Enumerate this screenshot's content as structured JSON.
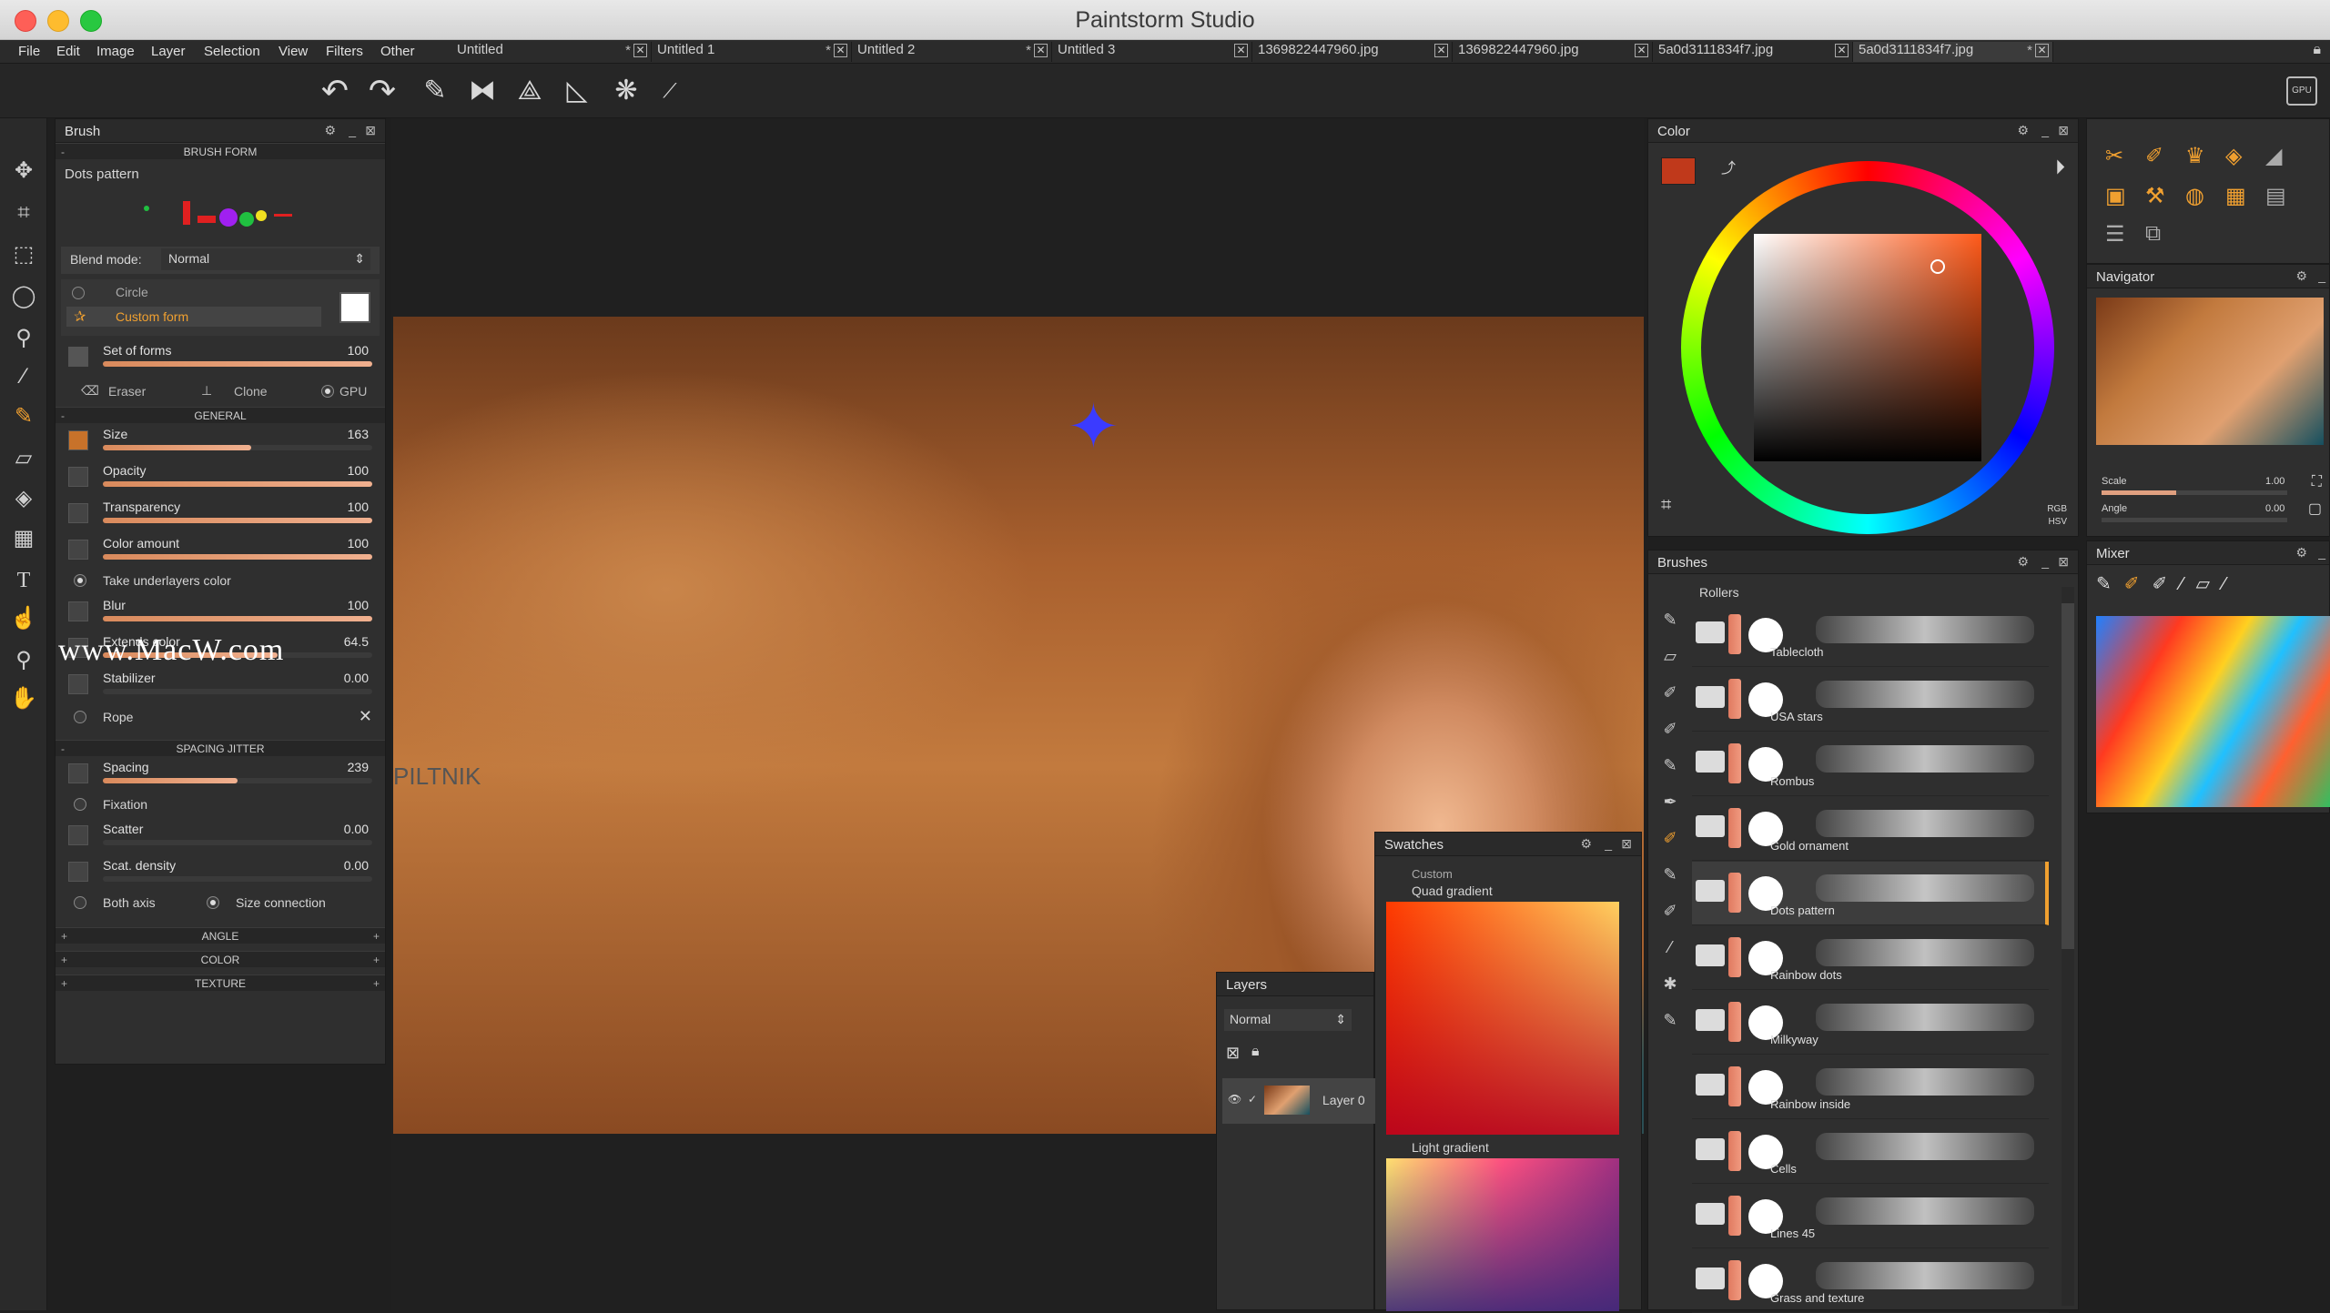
{
  "window": {
    "title": "Paintstorm Studio"
  },
  "menu": [
    "File",
    "Edit",
    "Image",
    "Layer",
    "Selection",
    "View",
    "Filters",
    "Other"
  ],
  "tabs": [
    {
      "label": "Untitled",
      "modified": "*",
      "active": false
    },
    {
      "label": "Untitled 1",
      "modified": "*",
      "active": false
    },
    {
      "label": "Untitled 2",
      "modified": "*",
      "active": false
    },
    {
      "label": "Untitled 3",
      "modified": "",
      "active": false
    },
    {
      "label": "1369822447960.jpg",
      "modified": "",
      "active": false
    },
    {
      "label": "1369822447960.jpg",
      "modified": "",
      "active": false
    },
    {
      "label": "5a0d3111834f7.jpg",
      "modified": "",
      "active": false
    },
    {
      "label": "5a0d3111834f7.jpg",
      "modified": "*",
      "active": true
    }
  ],
  "toolbar": {
    "icons": [
      "undo-icon",
      "redo-icon",
      "brush-icon",
      "symmetry-icon",
      "perspective-icon",
      "ruler-icon",
      "mandala-icon",
      "line-icon"
    ],
    "gpu_label": "GPU"
  },
  "left_tools": [
    "move-icon",
    "crop-icon",
    "rect-select-icon",
    "lasso-icon",
    "magic-wand-icon",
    "eyedropper-icon",
    "brush-icon",
    "eraser-icon",
    "fill-icon",
    "gradient-icon",
    "text-icon",
    "smudge-icon",
    "zoom-icon",
    "hand-icon"
  ],
  "brush_panel": {
    "title": "Brush",
    "brush_form_header": "BRUSH FORM",
    "brush_name": "Dots pattern",
    "blend_mode_label": "Blend mode:",
    "blend_mode_value": "Normal",
    "form_options": [
      {
        "label": "Circle",
        "selected": false
      },
      {
        "label": "Custom form",
        "selected": true
      }
    ],
    "set_of_forms": {
      "label": "Set of forms",
      "value": "100",
      "fraction": 1.0
    },
    "modes": [
      {
        "label": "Eraser"
      },
      {
        "label": "Clone"
      },
      {
        "label": "GPU",
        "checked": true
      }
    ],
    "general_header": "GENERAL",
    "general": [
      {
        "label": "Size",
        "value": "163",
        "fraction": 0.55
      },
      {
        "label": "Opacity",
        "value": "100",
        "fraction": 1.0
      },
      {
        "label": "Transparency",
        "value": "100",
        "fraction": 1.0
      },
      {
        "label": "Color amount",
        "value": "100",
        "fraction": 1.0
      }
    ],
    "take_underlayers": "Take underlayers color",
    "general2": [
      {
        "label": "Blur",
        "value": "100",
        "fraction": 1.0
      },
      {
        "label": "Extends color",
        "value": "64.5",
        "fraction": 0.65
      },
      {
        "label": "Stabilizer",
        "value": "0.00",
        "fraction": 0.0
      }
    ],
    "rope": "Rope",
    "spacing_header": "SPACING JITTER",
    "spacing": {
      "label": "Spacing",
      "value": "239",
      "fraction": 0.5
    },
    "fixation": "Fixation",
    "scatter": {
      "label": "Scatter",
      "value": "0.00",
      "fraction": 0.0
    },
    "scat_density": {
      "label": "Scat. density",
      "value": "0.00",
      "fraction": 0.0
    },
    "both_axis": "Both axis",
    "size_connection": "Size connection",
    "collapsed": [
      "ANGLE",
      "COLOR",
      "TEXTURE"
    ]
  },
  "watermark": "www.MacW.com",
  "photo_credit": "PILTNIK",
  "color_panel": {
    "title": "Color",
    "primary": "#c0391b",
    "secondary": "#8a1f10",
    "mode_labels": [
      "RGB",
      "HSV"
    ]
  },
  "navigator": {
    "title": "Navigator",
    "scale_label": "Scale",
    "scale_value": "1.00",
    "angle_label": "Angle",
    "angle_value": "0.00"
  },
  "mixer": {
    "title": "Mixer"
  },
  "brushes_panel": {
    "title": "Brushes",
    "category": "Rollers",
    "items": [
      {
        "name": "Tablecloth"
      },
      {
        "name": "USA stars"
      },
      {
        "name": "Rombus"
      },
      {
        "name": "Gold ornament"
      },
      {
        "name": "Dots pattern",
        "selected": true
      },
      {
        "name": "Rainbow dots"
      },
      {
        "name": "Milkyway"
      },
      {
        "name": "Rainbow inside"
      },
      {
        "name": "Cells"
      },
      {
        "name": "Lines 45"
      },
      {
        "name": "Grass and texture"
      }
    ]
  },
  "swatches": {
    "title": "Swatches",
    "groups": [
      "Custom",
      "Quad gradient",
      "Light gradient"
    ]
  },
  "layers": {
    "title": "Layers",
    "blend_mode": "Normal",
    "items": [
      {
        "name": "Layer 0",
        "visible": true,
        "checked": true
      }
    ]
  }
}
